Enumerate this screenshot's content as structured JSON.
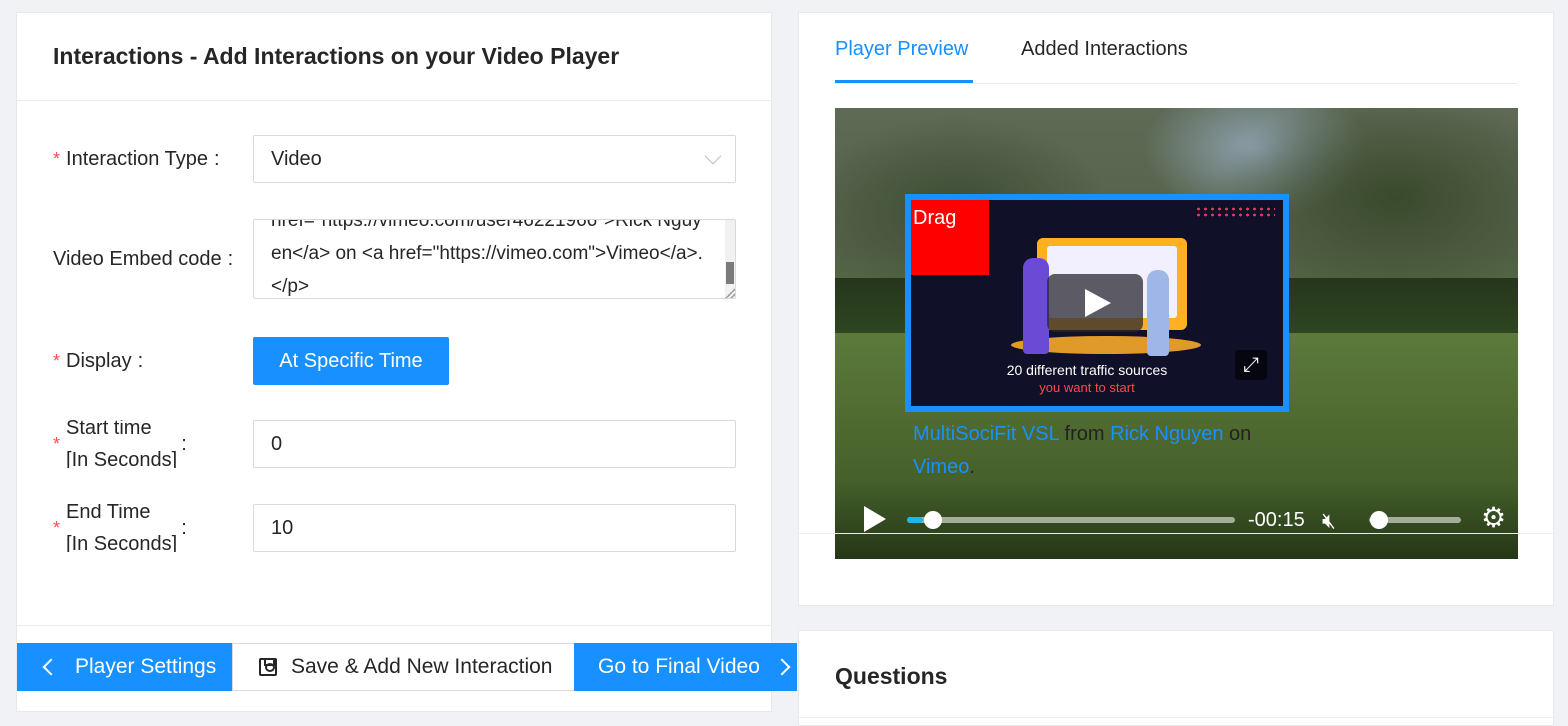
{
  "form": {
    "title": "Interactions - Add Interactions on your Video Player",
    "interaction_type": {
      "label": "Interaction Type",
      "colon": ":",
      "value": "Video"
    },
    "embed_code": {
      "label": "Video Embed code",
      "colon": ":",
      "value": "href=\"https://vimeo.com/user46221966\">Rick Nguyen</a> on <a href=\"https://vimeo.com\">Vimeo</a>.</p>"
    },
    "display": {
      "label": "Display",
      "colon": ":",
      "button": "At Specific Time"
    },
    "start_time": {
      "label_line1": "Start time",
      "label_line2": "[In Seconds]",
      "colon": ":",
      "value": "0"
    },
    "end_time": {
      "label_line1": "End Time",
      "label_line2": "[In Seconds]",
      "colon": ":",
      "value": "10"
    },
    "required_mark": "*"
  },
  "footer": {
    "player_settings": "Player Settings",
    "save_add": "Save & Add New Interaction",
    "final_video": "Go to Final Video"
  },
  "preview": {
    "tabs": [
      "Player Preview",
      "Added Interactions"
    ],
    "active_tab": 0,
    "drag_label": "Drag",
    "inner_caption_1": "20 different traffic sources",
    "inner_caption_2": "you want to start",
    "credit": {
      "video": "MultiSociFit VSL",
      "from": "from",
      "author": "Rick Nguyen",
      "on": "on",
      "site": "Vimeo",
      "end": "."
    },
    "time_remaining": "-00:15",
    "progress_fraction": 0.05,
    "volume_fraction": 0.0,
    "muted": true
  },
  "questions": {
    "title": "Questions"
  },
  "colors": {
    "accent": "#1890ff",
    "required": "#ff4d4f"
  }
}
